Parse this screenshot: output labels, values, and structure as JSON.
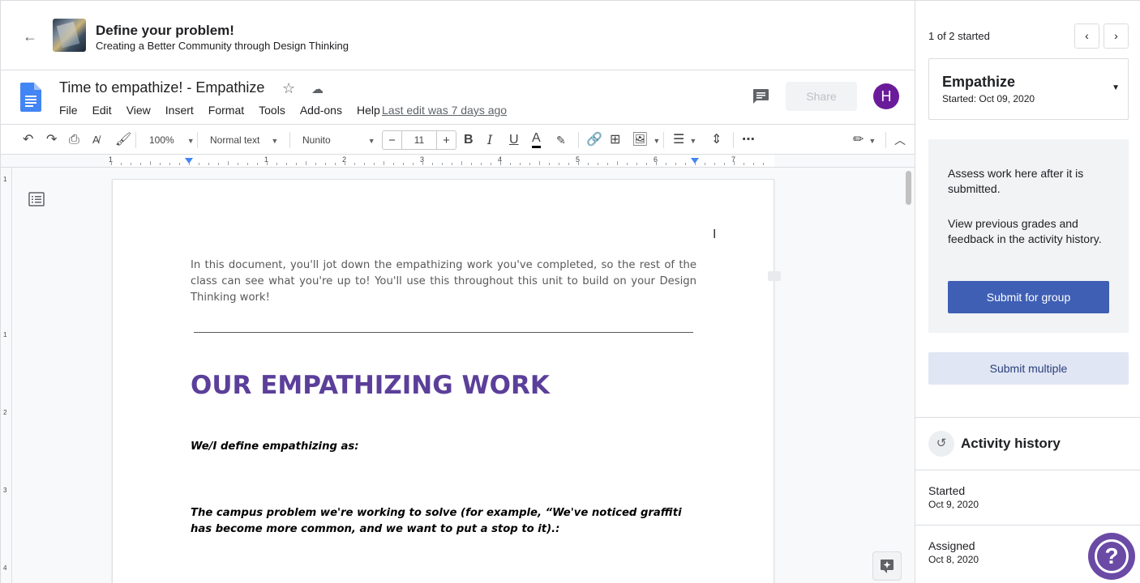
{
  "topbar": {
    "back_icon": "arrow-left-icon",
    "title": "Define your problem!",
    "subtitle": "Creating a Better Community through Design Thinking"
  },
  "doc": {
    "title": "Time to empathize! - Empathize",
    "menu": [
      "File",
      "Edit",
      "View",
      "Insert",
      "Format",
      "Tools",
      "Add-ons",
      "Help"
    ],
    "last_edit": "Last edit was 7 days ago",
    "share_label": "Share",
    "avatar_letter": "H",
    "avatar_color": "#6a1b9a"
  },
  "toolbar": {
    "zoom": "100%",
    "style": "Normal text",
    "font": "Nunito",
    "font_size": "11",
    "minus": "−",
    "plus": "+"
  },
  "ruler": {
    "numbers": [
      "1",
      "1",
      "2",
      "3",
      "4",
      "5",
      "6",
      "7"
    ]
  },
  "vruler": {
    "numbers": [
      "1",
      "1",
      "2",
      "3",
      "4"
    ]
  },
  "body": {
    "intro": "In this document, you'll jot down the empathizing work you've completed, so the rest of the class can see what you're up to! You'll use this throughout this unit to build on your Design Thinking work!",
    "heading": "OUR EMPATHIZING WORK",
    "heading_color": "#5b3f9a",
    "q1": "We/I define empathizing as:",
    "q2": "The campus problem we're working to solve (for example, “We've noticed graffiti has become more common, and we want to put a stop to it).:"
  },
  "panel": {
    "started_count": "1 of 2 started",
    "step_name": "Empathize",
    "step_date": "Started: Oct 09, 2020",
    "assess_1": "Assess work here after it is submitted.",
    "assess_2": "View previous grades and feedback in the activity history.",
    "submit_group": "Submit for group",
    "submit_multiple": "Submit multiple",
    "history_title": "Activity history",
    "history": [
      {
        "label": "Started",
        "date": "Oct 9, 2020"
      },
      {
        "label": "Assigned",
        "date": "Oct 8, 2020"
      }
    ],
    "accent": "#3f5fb5"
  }
}
